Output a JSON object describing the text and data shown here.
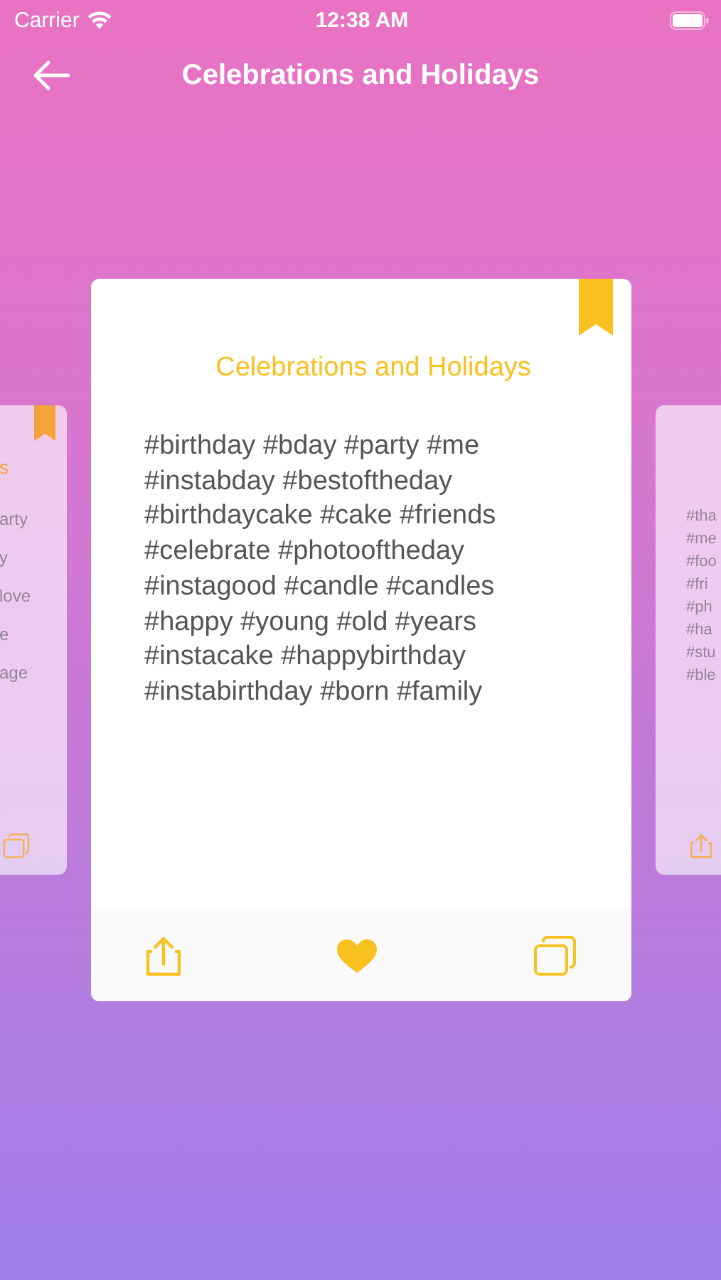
{
  "status_bar": {
    "carrier": "Carrier",
    "time": "12:38 AM"
  },
  "nav": {
    "title": "Celebrations and Holidays"
  },
  "cards": [
    {
      "kind": "left",
      "bookmarked": true,
      "title": "s",
      "lines": [
        "arty",
        "y",
        "love",
        "e",
        "age"
      ],
      "actions": [
        {
          "kind": "copy"
        }
      ]
    },
    {
      "kind": "center",
      "bookmarked": true,
      "title": "Celebrations and Holidays",
      "lines": [
        "#birthday #bday #party #me",
        "#instabday #bestoftheday",
        "#birthdaycake #cake #friends",
        "#celebrate #photooftheday",
        "#instagood #candle #candles",
        "#happy #young #old #years",
        "#instacake #happybirthday",
        "#instabirthday #born #family"
      ],
      "actions": [
        {
          "kind": "share"
        },
        {
          "kind": "like",
          "liked": true
        },
        {
          "kind": "copy"
        }
      ]
    },
    {
      "kind": "right",
      "lines": [
        "#tha",
        "#me",
        "#foo",
        "#fri",
        "#ph",
        "#ha",
        "#stu",
        "#ble"
      ],
      "actions": [
        {
          "kind": "share"
        }
      ]
    }
  ]
}
